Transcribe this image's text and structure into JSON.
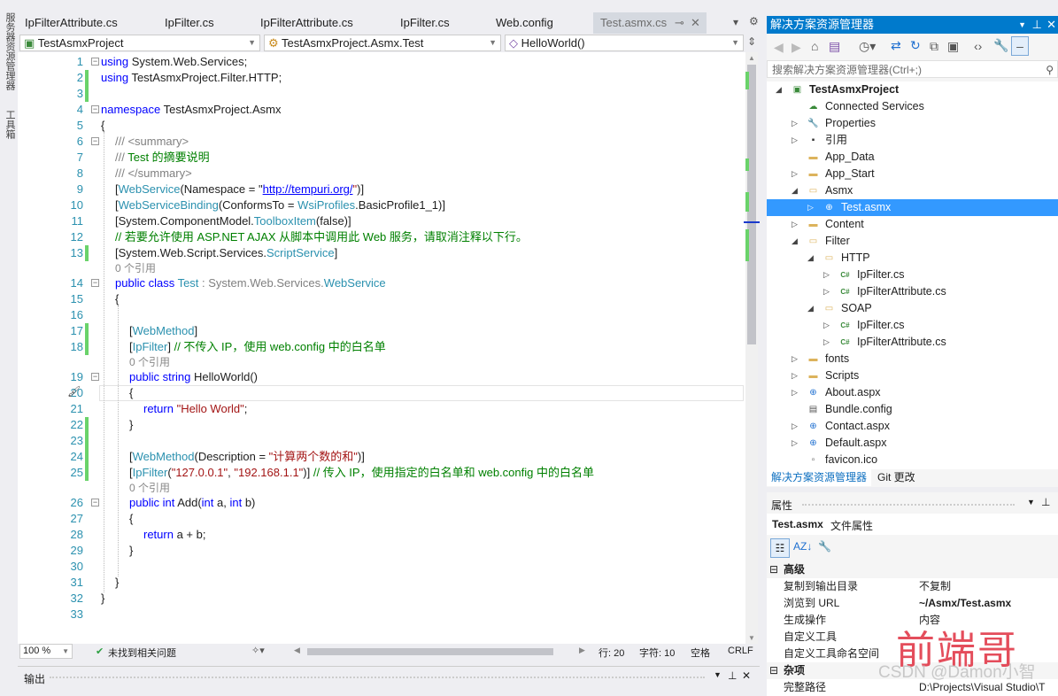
{
  "left_strip": [
    "服务器资源管理器",
    "工具箱"
  ],
  "tabs": [
    {
      "label": "IpFilterAttribute.cs"
    },
    {
      "label": "IpFilter.cs"
    },
    {
      "label": "IpFilterAttribute.cs"
    },
    {
      "label": "IpFilter.cs"
    },
    {
      "label": "Web.config"
    },
    {
      "label": "Test.asmx.cs",
      "active": true
    }
  ],
  "nav": {
    "project": "TestAsmxProject",
    "class": "TestAsmxProject.Asmx.Test",
    "member": "HelloWorld()"
  },
  "code": [
    {
      "n": "1",
      "i": 0,
      "fold": "-",
      "t": [
        [
          "kw",
          "using"
        ],
        [
          "",
          " System.Web.Services;"
        ]
      ]
    },
    {
      "n": "2",
      "i": 0,
      "t": [
        [
          "kw",
          "using"
        ],
        [
          "",
          " TestAsmxProject.Filter.HTTP;"
        ]
      ]
    },
    {
      "n": "3",
      "i": 0,
      "t": []
    },
    {
      "n": "4",
      "i": 0,
      "fold": "-",
      "t": [
        [
          "kw",
          "namespace"
        ],
        [
          "",
          " TestAsmxProject.Asmx"
        ]
      ]
    },
    {
      "n": "5",
      "i": 0,
      "t": [
        [
          "",
          "{"
        ]
      ]
    },
    {
      "n": "6",
      "i": 1,
      "fold": "-",
      "t": [
        [
          "gr",
          "/// <summary>"
        ]
      ]
    },
    {
      "n": "7",
      "i": 1,
      "t": [
        [
          "gr",
          "/// "
        ],
        [
          "cm",
          "Test 的摘要说明"
        ]
      ]
    },
    {
      "n": "8",
      "i": 1,
      "t": [
        [
          "gr",
          "/// </summary>"
        ]
      ]
    },
    {
      "n": "9",
      "i": 1,
      "t": [
        [
          "",
          "["
        ],
        [
          "ty",
          "WebService"
        ],
        [
          "",
          "(Namespace = \""
        ],
        [
          "lnk",
          "http://tempuri.org/"
        ],
        [
          "str",
          "\""
        ],
        [
          "",
          ")]"
        ]
      ]
    },
    {
      "n": "10",
      "i": 1,
      "t": [
        [
          "",
          "["
        ],
        [
          "ty",
          "WebServiceBinding"
        ],
        [
          "",
          "(ConformsTo = "
        ],
        [
          "ty",
          "WsiProfiles"
        ],
        [
          "",
          ".BasicProfile1_1)]"
        ]
      ]
    },
    {
      "n": "11",
      "i": 1,
      "t": [
        [
          "",
          "[System.ComponentModel."
        ],
        [
          "ty",
          "ToolboxItem"
        ],
        [
          "",
          "(false)]"
        ]
      ]
    },
    {
      "n": "12",
      "i": 1,
      "t": [
        [
          "cm",
          "// 若要允许使用 ASP.NET AJAX 从脚本中调用此 Web 服务，请取消注释以下行。"
        ]
      ]
    },
    {
      "n": "13",
      "i": 1,
      "t": [
        [
          "",
          "[System.Web.Script.Services."
        ],
        [
          "ty",
          "ScriptService"
        ],
        [
          "",
          "]"
        ]
      ]
    },
    {
      "lens": "0 个引用",
      "i": 1
    },
    {
      "n": "14",
      "i": 1,
      "fold": "-",
      "t": [
        [
          "kw",
          "public class "
        ],
        [
          "ty",
          "Test"
        ],
        [
          "gr",
          " : System.Web.Services."
        ],
        [
          "ty",
          "WebService"
        ]
      ]
    },
    {
      "n": "15",
      "i": 1,
      "t": [
        [
          "",
          "{"
        ]
      ]
    },
    {
      "n": "16",
      "i": 2,
      "t": []
    },
    {
      "n": "17",
      "i": 2,
      "t": [
        [
          "",
          "["
        ],
        [
          "ty",
          "WebMethod"
        ],
        [
          "",
          "]"
        ]
      ]
    },
    {
      "n": "18",
      "i": 2,
      "t": [
        [
          "",
          "["
        ],
        [
          "ty",
          "IpFilter"
        ],
        [
          "",
          "] "
        ],
        [
          "cm",
          "// 不传入 IP，使用 web.config 中的白名单"
        ]
      ]
    },
    {
      "lens": "0 个引用",
      "i": 2
    },
    {
      "n": "19",
      "i": 2,
      "fold": "-",
      "t": [
        [
          "kw",
          "public string "
        ],
        [
          "",
          "HelloWorld()"
        ]
      ]
    },
    {
      "n": "20",
      "i": 2,
      "cur": true,
      "t": [
        [
          "",
          "{"
        ]
      ]
    },
    {
      "n": "21",
      "i": 3,
      "t": [
        [
          "kw",
          "return "
        ],
        [
          "str",
          "\"Hello World\""
        ],
        [
          "",
          ";"
        ]
      ]
    },
    {
      "n": "22",
      "i": 2,
      "t": [
        [
          "",
          "}"
        ]
      ]
    },
    {
      "n": "23",
      "i": 2,
      "t": []
    },
    {
      "n": "24",
      "i": 2,
      "t": [
        [
          "",
          "["
        ],
        [
          "ty",
          "WebMethod"
        ],
        [
          "",
          "(Description = "
        ],
        [
          "str",
          "\"计算两个数的和\""
        ],
        [
          "",
          ")]"
        ]
      ]
    },
    {
      "n": "25",
      "i": 2,
      "t": [
        [
          "",
          "["
        ],
        [
          "ty",
          "IpFilter"
        ],
        [
          "",
          "("
        ],
        [
          "str",
          "\"127.0.0.1\""
        ],
        [
          "",
          ", "
        ],
        [
          "str",
          "\"192.168.1.1\""
        ],
        [
          "",
          ")] "
        ],
        [
          "cm",
          "// 传入 IP，使用指定的白名单和 web.config 中的白名单"
        ]
      ]
    },
    {
      "lens": "0 个引用",
      "i": 2
    },
    {
      "n": "26",
      "i": 2,
      "fold": "-",
      "t": [
        [
          "kw",
          "public int "
        ],
        [
          "",
          "Add("
        ],
        [
          "kw",
          "int"
        ],
        [
          "",
          " a, "
        ],
        [
          "kw",
          "int"
        ],
        [
          "",
          " b)"
        ]
      ]
    },
    {
      "n": "27",
      "i": 2,
      "t": [
        [
          "",
          "{"
        ]
      ]
    },
    {
      "n": "28",
      "i": 3,
      "t": [
        [
          "kw",
          "return"
        ],
        [
          "",
          " a + b;"
        ]
      ]
    },
    {
      "n": "29",
      "i": 2,
      "t": [
        [
          "",
          "}"
        ]
      ]
    },
    {
      "n": "30",
      "i": 2,
      "t": []
    },
    {
      "n": "31",
      "i": 1,
      "t": [
        [
          "",
          "}"
        ]
      ]
    },
    {
      "n": "32",
      "i": 0,
      "t": [
        [
          "",
          "}"
        ]
      ]
    },
    {
      "n": "33",
      "i": 0,
      "t": []
    }
  ],
  "status": {
    "zoom": "100 %",
    "issues": "未找到相关问题",
    "line": "行: 20",
    "char": "字符: 10",
    "spaces": "空格",
    "eol": "CRLF"
  },
  "output": {
    "title": "输出"
  },
  "solution_explorer": {
    "title": "解决方案资源管理器",
    "search_placeholder": "搜索解决方案资源管理器(Ctrl+;)",
    "tree": [
      {
        "label": "TestAsmxProject",
        "lvl": 0,
        "exp": "open",
        "icon": "web-project",
        "bold": true
      },
      {
        "label": "Connected Services",
        "lvl": 1,
        "icon": "connected-services"
      },
      {
        "label": "Properties",
        "lvl": 1,
        "exp": "closed",
        "icon": "wrench"
      },
      {
        "label": "引用",
        "lvl": 1,
        "exp": "closed",
        "icon": "references"
      },
      {
        "label": "App_Data",
        "lvl": 1,
        "icon": "folder"
      },
      {
        "label": "App_Start",
        "lvl": 1,
        "exp": "closed",
        "icon": "folder"
      },
      {
        "label": "Asmx",
        "lvl": 1,
        "exp": "open",
        "icon": "folder-open"
      },
      {
        "label": "Test.asmx",
        "lvl": 2,
        "exp": "closed",
        "icon": "web-service",
        "selected": true
      },
      {
        "label": "Content",
        "lvl": 1,
        "exp": "closed",
        "icon": "folder"
      },
      {
        "label": "Filter",
        "lvl": 1,
        "exp": "open",
        "icon": "folder-open"
      },
      {
        "label": "HTTP",
        "lvl": 2,
        "exp": "open",
        "icon": "folder-open"
      },
      {
        "label": "IpFilter.cs",
        "lvl": 3,
        "exp": "closed",
        "icon": "csharp"
      },
      {
        "label": "IpFilterAttribute.cs",
        "lvl": 3,
        "exp": "closed",
        "icon": "csharp"
      },
      {
        "label": "SOAP",
        "lvl": 2,
        "exp": "open",
        "icon": "folder-open"
      },
      {
        "label": "IpFilter.cs",
        "lvl": 3,
        "exp": "closed",
        "icon": "csharp"
      },
      {
        "label": "IpFilterAttribute.cs",
        "lvl": 3,
        "exp": "closed",
        "icon": "csharp"
      },
      {
        "label": "fonts",
        "lvl": 1,
        "exp": "closed",
        "icon": "folder"
      },
      {
        "label": "Scripts",
        "lvl": 1,
        "exp": "closed",
        "icon": "folder"
      },
      {
        "label": "About.aspx",
        "lvl": 1,
        "exp": "closed",
        "icon": "web-page"
      },
      {
        "label": "Bundle.config",
        "lvl": 1,
        "icon": "config"
      },
      {
        "label": "Contact.aspx",
        "lvl": 1,
        "exp": "closed",
        "icon": "web-page"
      },
      {
        "label": "Default.aspx",
        "lvl": 1,
        "exp": "closed",
        "icon": "web-page"
      },
      {
        "label": "favicon.ico",
        "lvl": 1,
        "icon": "image"
      }
    ],
    "tabs": [
      "解决方案资源管理器",
      "Git 更改"
    ]
  },
  "properties": {
    "title": "属性",
    "object": "Test.asmx",
    "object_type": "文件属性",
    "sections": [
      {
        "name": "高级",
        "rows": [
          [
            "复制到输出目录",
            "不复制"
          ],
          [
            "浏览到 URL",
            "~/Asmx/Test.asmx"
          ],
          [
            "生成操作",
            "内容"
          ],
          [
            "自定义工具",
            ""
          ],
          [
            "自定义工具命名空间",
            ""
          ]
        ]
      },
      {
        "name": "杂项",
        "rows": [
          [
            "完整路径",
            "D:\\Projects\\Visual Studio\\T"
          ]
        ]
      }
    ]
  },
  "watermark": {
    "text": "前端哥",
    "csdn": "CSDN @Damon小智"
  },
  "colors": {
    "accent": "#007acc",
    "selection": "#3399ff",
    "change_bar": "#6ad36a"
  }
}
